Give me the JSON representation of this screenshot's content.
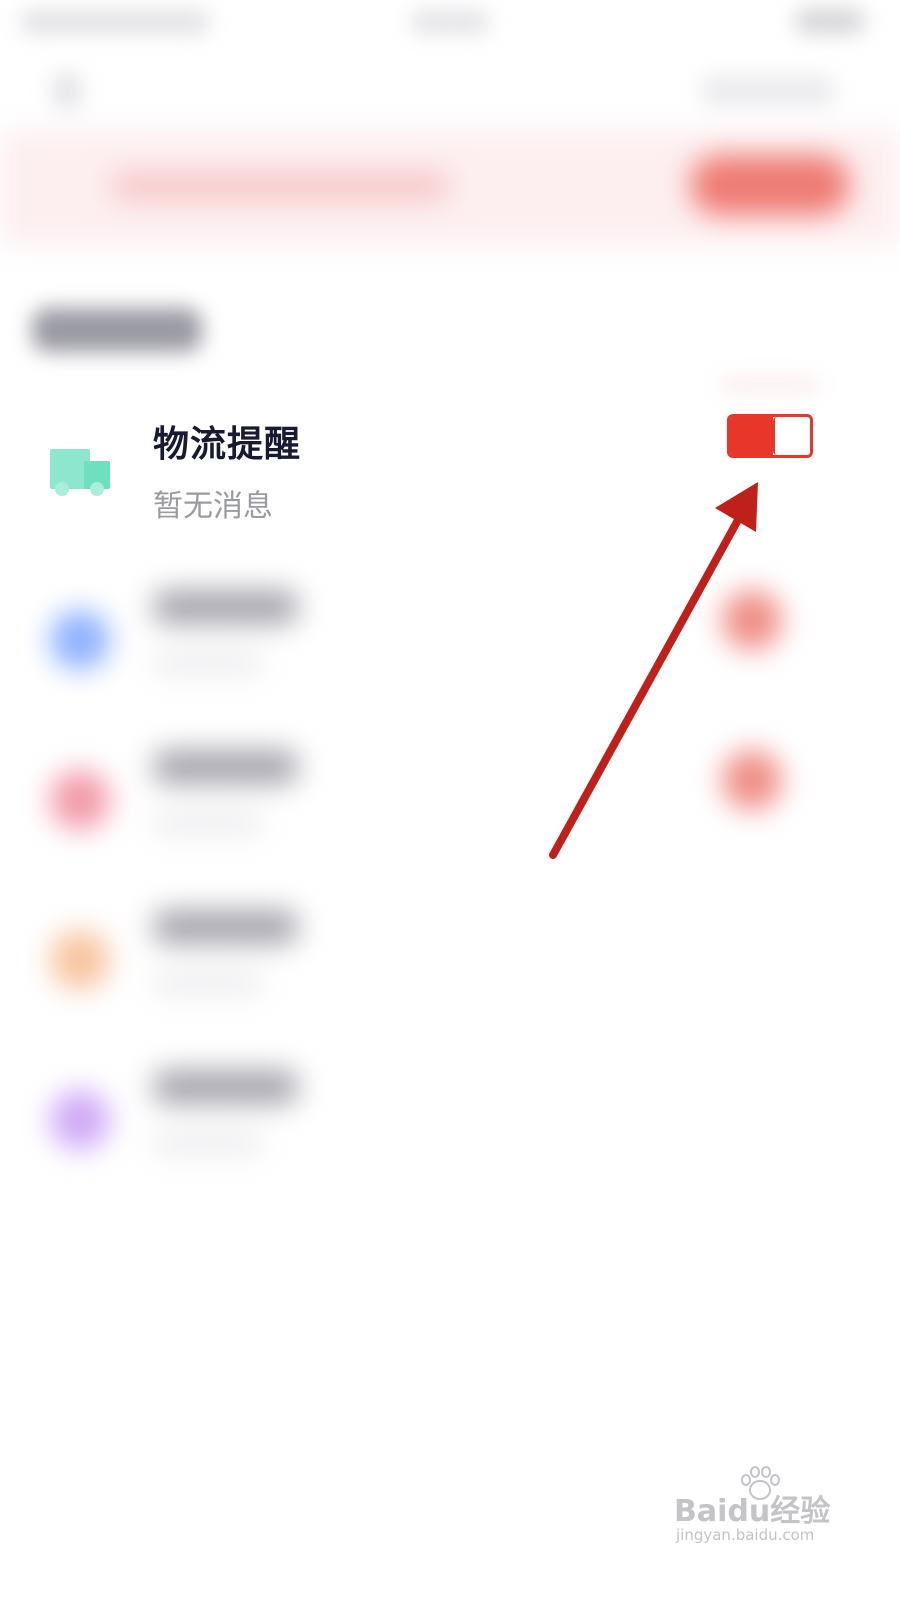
{
  "logistics": {
    "title": "物流提醒",
    "subtitle": "暂无消息",
    "toggle_state": "on"
  },
  "colors": {
    "accent_red": "#e8362b",
    "arrow_red": "#c0201a",
    "icon_green": "#6ee0c0"
  },
  "watermark": {
    "brand": "Baidu经验",
    "url": "jingyan.baidu.com"
  }
}
